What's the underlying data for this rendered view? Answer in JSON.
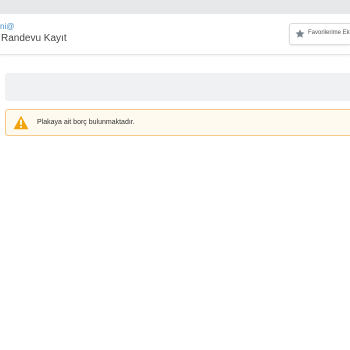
{
  "header": {
    "breadcrumb": "ni@",
    "title": "Randevu Kayıt",
    "favorite_label": "Favorilerime Ek",
    "favorite_icon": "star-icon"
  },
  "alert": {
    "icon": "warning-icon",
    "message": "Plakaya ait borç bulunmaktadır."
  },
  "colors": {
    "accent": "#4a90c8",
    "warning": "#f0a30a",
    "alert_border": "#f5c98a",
    "alert_background": "#fffaf0"
  }
}
